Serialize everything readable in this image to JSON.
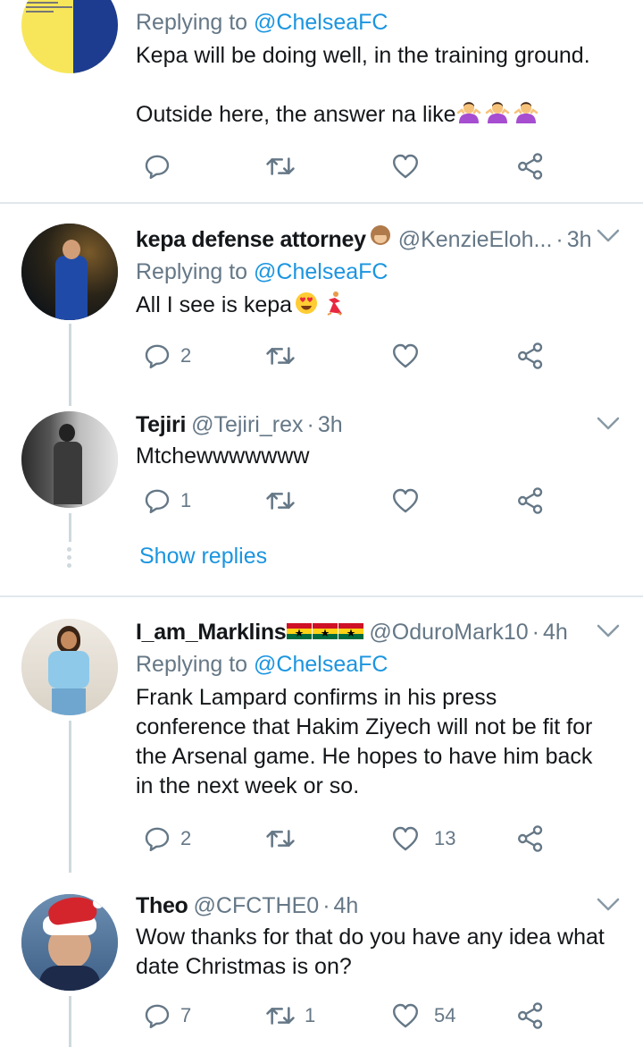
{
  "colors": {
    "accent": "#1b95e0",
    "muted": "#657786",
    "text": "#14171a",
    "separator": "#e1e8ed",
    "thread": "#cfd9de"
  },
  "tweets": [
    {
      "reply_prefix": "Replying to",
      "reply_mention": "@ChelseaFC",
      "text_line1": "Kepa will be doing well, in the training ground.",
      "text_line2": "Outside here, the answer na like"
    },
    {
      "display_name": "kepa defense attorney",
      "handle": "@KenzieEloh...",
      "time": "3h",
      "reply_prefix": "Replying to",
      "reply_mention": "@ChelseaFC",
      "text": "All I see is kepa",
      "reply_count": "2"
    },
    {
      "display_name": "Tejiri",
      "handle": "@Tejiri_rex",
      "time": "3h",
      "text": "Mtchewwwwwww",
      "reply_count": "1",
      "show_replies": "Show replies"
    },
    {
      "display_name": "I_am_Marklins",
      "handle": "@OduroMark10",
      "time": "4h",
      "reply_prefix": "Replying to",
      "reply_mention": "@ChelseaFC",
      "text": "Frank Lampard confirms in his press conference that Hakim Ziyech will not be fit for the Arsenal game. He hopes to have him back in the next week or so.",
      "reply_count": "2",
      "like_count": "13"
    },
    {
      "display_name": "Theo",
      "handle": "@CFCTHE0",
      "time": "4h",
      "text": "Wow thanks for that do you have any idea what date Christmas is on?",
      "reply_count": "7",
      "retweet_count": "1",
      "like_count": "54"
    }
  ],
  "icons": {
    "reply": "reply-icon",
    "retweet": "retweet-icon",
    "like": "heart-icon",
    "share": "share-icon",
    "menu": "chevron-down-icon"
  }
}
